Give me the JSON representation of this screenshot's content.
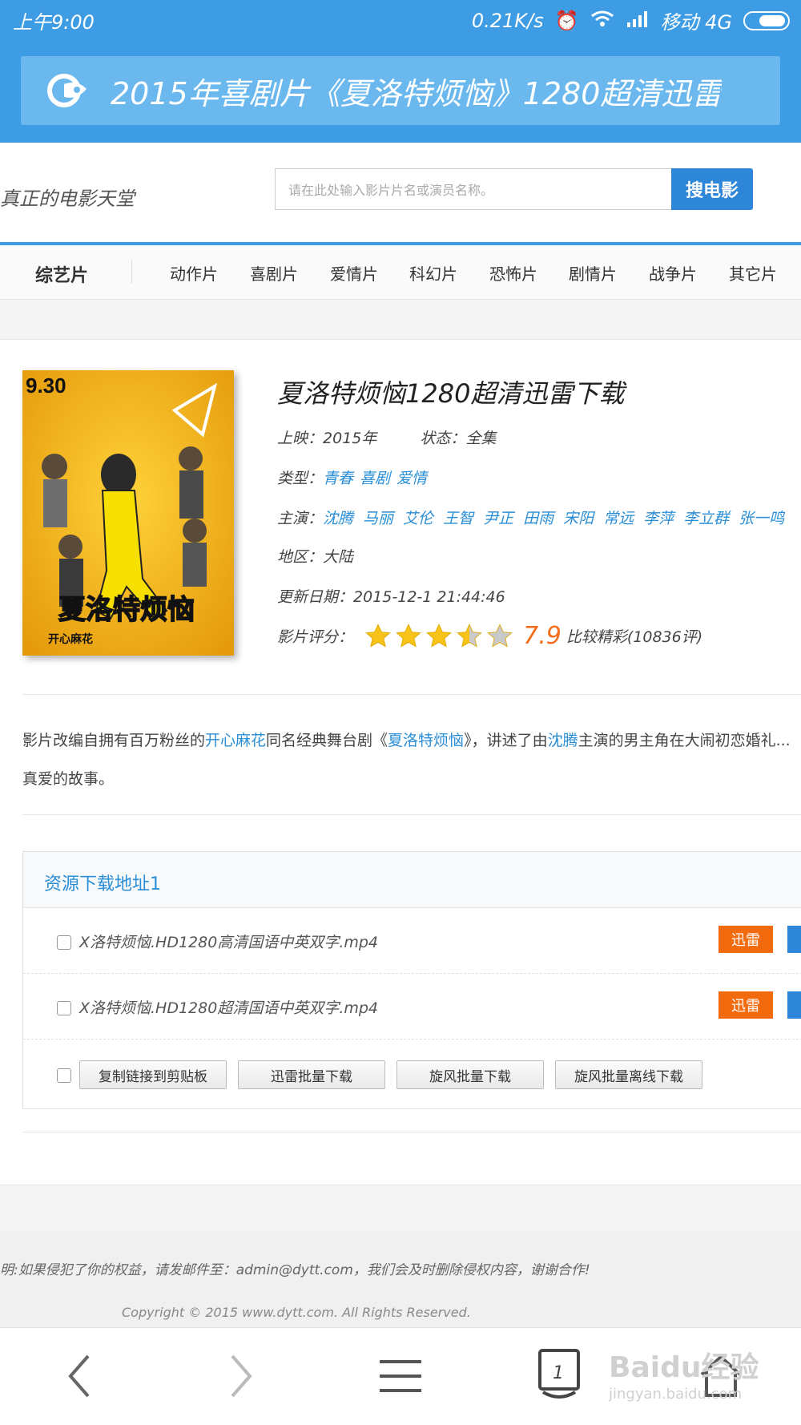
{
  "status": {
    "time": "上午9:00",
    "speed": "0.21K/s",
    "carrier": "移动 4G"
  },
  "browser": {
    "page_title": "2015年喜剧片《夏洛特烦恼》1280超清迅雷",
    "tab_count": "1"
  },
  "site": {
    "slogan": "真正的电影天堂",
    "search_placeholder": "请在此处输入影片片名或演员名称。",
    "search_button": "搜电影"
  },
  "nav": {
    "first": "综艺片",
    "items": [
      "动作片",
      "喜剧片",
      "爱情片",
      "科幻片",
      "恐怖片",
      "剧情片",
      "战争片",
      "其它片"
    ]
  },
  "movie": {
    "title": "夏洛特烦恼1280超清迅雷下载",
    "release_label": "上映：",
    "release": "2015年",
    "state_label": "状态：",
    "state": "全集",
    "genre_label": "类型：",
    "genres": [
      "青春",
      "喜剧",
      "爱情"
    ],
    "cast_label": "主演：",
    "cast": [
      "沈腾",
      "马丽",
      "艾伦",
      "王智",
      "尹正",
      "田雨",
      "宋阳",
      "常远",
      "李萍",
      "李立群",
      "张一鸣"
    ],
    "region_label": "地区：",
    "region": "大陆",
    "updated_label": "更新日期：",
    "updated": "2015-12-1 21:44:46",
    "rating_label": "影片评分：",
    "rating_stars": 3.5,
    "score": "7.9",
    "score_text": "比较精彩(10836评)",
    "poster_date": "9.30",
    "poster_title": "夏洛特烦恼",
    "poster_brand": "开心麻花"
  },
  "description": {
    "part1": "影片改编自拥有百万粉丝的",
    "link1": "开心麻花",
    "part2": "同名经典舞台剧《",
    "link2": "夏洛特烦恼",
    "part3": "》，讲述了由",
    "link3": "沈腾",
    "part4": "主演的男主角在大闹初恋婚礼...",
    "line2": "真爱的故事。"
  },
  "downloads": {
    "heading": "资源下载地址1",
    "files": [
      {
        "name": "X洛特烦恼.HD1280高清国语中英双字.mp4",
        "button": "迅雷"
      },
      {
        "name": "X洛特烦恼.HD1280超清国语中英双字.mp4",
        "button": "迅雷"
      }
    ],
    "actions": [
      "复制链接到剪贴板",
      "迅雷批量下载",
      "旋风批量下载",
      "旋风批量离线下载"
    ]
  },
  "footer": {
    "statement": "明:如果侵犯了你的权益，请发邮件至：admin@dytt.com，我们会及时删除侵权内容，谢谢合作!",
    "copyright": "Copyright © 2015 www.dytt.com. All Rights Reserved."
  },
  "watermark": {
    "brand": "Baidu经验",
    "url": "jingyan.baidu.com"
  },
  "colors": {
    "brand_blue": "#3d9ce4",
    "link_blue": "#2a8ed6",
    "accent_orange": "#f26a0e"
  }
}
